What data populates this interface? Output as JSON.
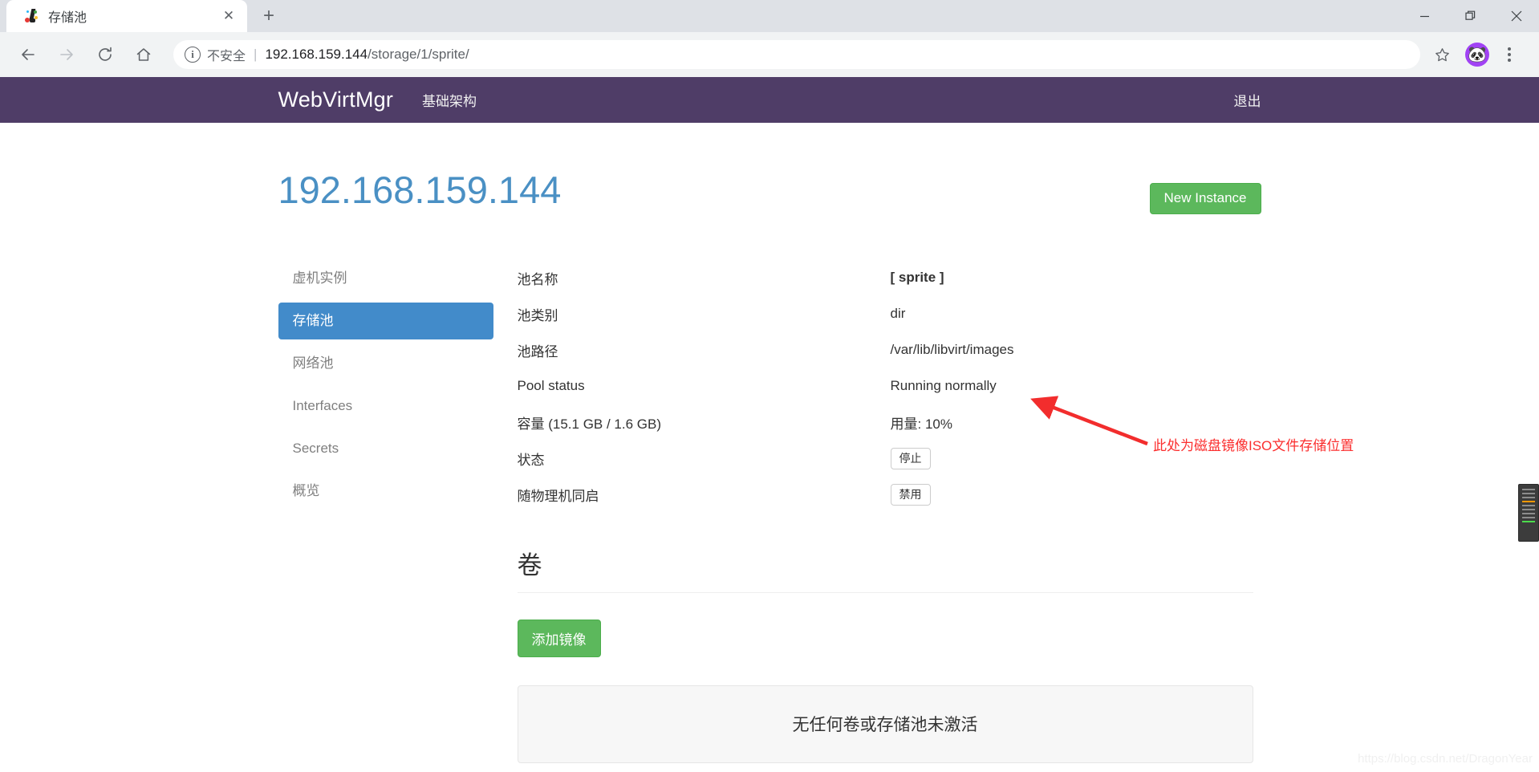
{
  "browser": {
    "tab": {
      "title": "存储池",
      "favicon_name": "webvirtmgr-favicon",
      "close_label": "✕"
    },
    "new_tab_label": "+",
    "window_controls": {
      "minimize": "minimize-icon",
      "maximize": "maximize-icon",
      "close": "close-icon"
    },
    "toolbar": {
      "back": "back-arrow-icon",
      "forward": "forward-arrow-icon",
      "reload": "reload-icon",
      "home": "home-icon",
      "security_label": "不安全",
      "separator": "|",
      "url_host": "192.168.159.144",
      "url_path": "/storage/1/sprite/",
      "bookmark": "star-icon",
      "profile": "profile-avatar",
      "profile_glyph": "🐼",
      "menu": "three-dot-menu-icon"
    }
  },
  "navbar": {
    "brand": "WebVirtMgr",
    "link": "基础架构",
    "logout": "退出",
    "bg_color": "#4f3d67"
  },
  "header": {
    "title": "192.168.159.144",
    "title_color": "#4a90c4",
    "new_instance_button": "New Instance",
    "green": "#5cb85c"
  },
  "sidebar": {
    "active_color": "#428bca",
    "items": [
      {
        "label": "虚机实例",
        "active": false
      },
      {
        "label": "存储池",
        "active": true
      },
      {
        "label": "网络池",
        "active": false
      },
      {
        "label": "Interfaces",
        "active": false
      },
      {
        "label": "Secrets",
        "active": false
      },
      {
        "label": "概览",
        "active": false
      }
    ]
  },
  "details": [
    {
      "label": "池名称",
      "value": "[ sprite ]",
      "style": "bold"
    },
    {
      "label": "池类别",
      "value": "dir",
      "style": "plain"
    },
    {
      "label": "池路径",
      "value": "/var/lib/libvirt/images",
      "style": "plain"
    },
    {
      "label": "Pool status",
      "value": "Running normally",
      "style": "plain"
    },
    {
      "label": "容量 (15.1 GB / 1.6 GB)",
      "value": "用量: 10%",
      "style": "plain"
    },
    {
      "label": "状态",
      "value": "停止",
      "style": "button"
    },
    {
      "label": "随物理机同启",
      "value": "禁用",
      "style": "button"
    }
  ],
  "volumes": {
    "section_title": "卷",
    "add_image_button": "添加镜像",
    "empty_message": "无任何卷或存储池未激活"
  },
  "annotation": {
    "text": "此处为磁盘镜像ISO文件存储位置",
    "color": "#fb2e2e"
  },
  "watermark": "https://blog.csdn.net/DragonYear"
}
